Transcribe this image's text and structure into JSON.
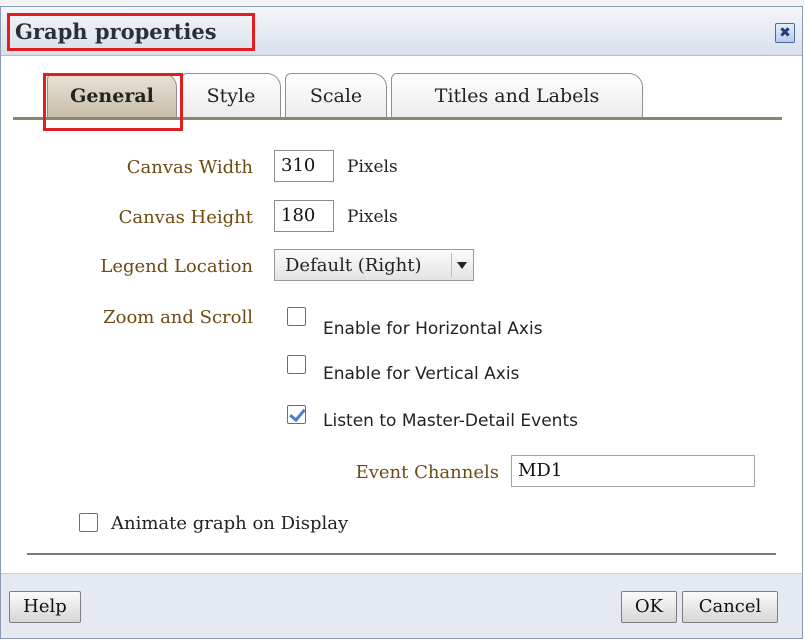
{
  "dialog": {
    "title": "Graph properties",
    "close_icon_glyph": "✖"
  },
  "tabs": [
    {
      "label": "General",
      "active": true
    },
    {
      "label": "Style",
      "active": false
    },
    {
      "label": "Scale",
      "active": false
    },
    {
      "label": "Titles and Labels",
      "active": false
    }
  ],
  "form": {
    "canvas_width": {
      "label": "Canvas Width",
      "value": "310",
      "unit": "Pixels"
    },
    "canvas_height": {
      "label": "Canvas Height",
      "value": "180",
      "unit": "Pixels"
    },
    "legend_location": {
      "label": "Legend Location",
      "selected": "Default (Right)"
    },
    "zoom_scroll": {
      "label": "Zoom and Scroll",
      "horizontal": {
        "label": "Enable for Horizontal Axis",
        "checked": false
      },
      "vertical": {
        "label": "Enable for Vertical Axis",
        "checked": false
      },
      "master_detail": {
        "label": "Listen to Master-Detail Events",
        "checked": true
      }
    },
    "event_channels": {
      "label": "Event Channels",
      "value": "MD1"
    },
    "animate": {
      "label": "Animate graph on Display",
      "checked": false
    }
  },
  "footer": {
    "help_label": "Help",
    "ok_label": "OK",
    "cancel_label": "Cancel"
  },
  "colors": {
    "highlight": "#e02020",
    "label_brown": "#6b4b12",
    "active_tab": "#c7bea7",
    "check_blue": "#4a7fc1"
  }
}
